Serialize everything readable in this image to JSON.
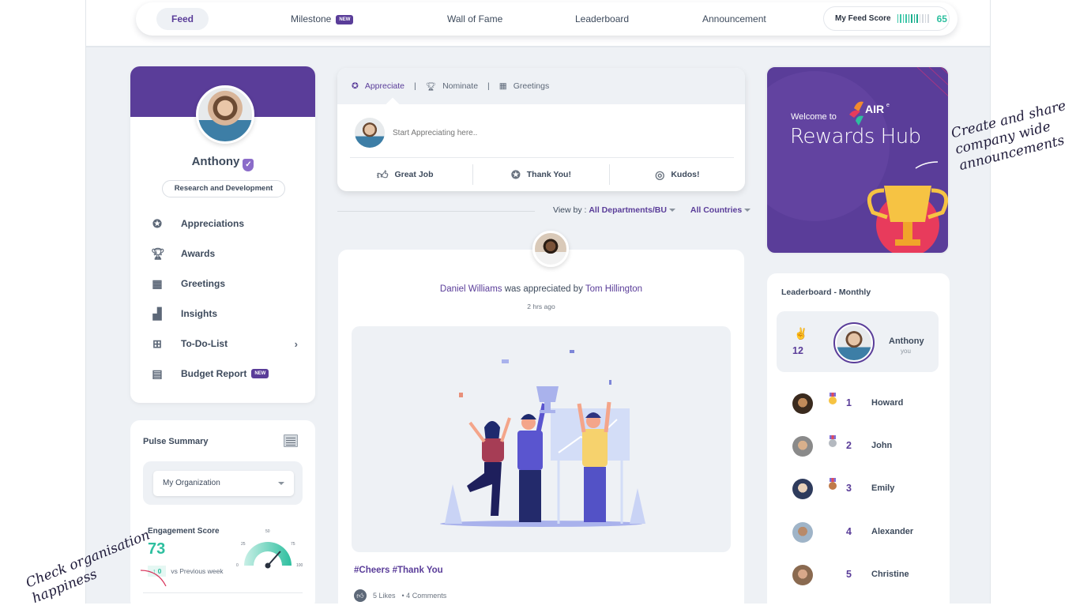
{
  "nav": {
    "tabs": [
      {
        "label": "Feed",
        "active": true
      },
      {
        "label": "Milestone",
        "badge": "NEW"
      },
      {
        "label": "Wall of Fame"
      },
      {
        "label": "Leaderboard"
      },
      {
        "label": "Announcement"
      }
    ],
    "feed_score": {
      "label": "My Feed Score",
      "value": "65",
      "segments_total": 12,
      "segments_filled": 8
    }
  },
  "profile": {
    "name": "Anthony",
    "verified_icon": "shield-check-icon",
    "department": "Research and Development",
    "menu": [
      {
        "label": "Appreciations",
        "icon": "ribbon-icon"
      },
      {
        "label": "Awards",
        "icon": "trophy-icon"
      },
      {
        "label": "Greetings",
        "icon": "gift-icon"
      },
      {
        "label": "Insights",
        "icon": "chart-icon"
      },
      {
        "label": "To-Do-List",
        "icon": "grid-icon",
        "has_submenu": true
      },
      {
        "label": "Budget Report",
        "icon": "clipboard-icon",
        "badge": "NEW"
      }
    ]
  },
  "pulse": {
    "title": "Pulse Summary",
    "org_select": "My Organization",
    "engagement_label": "Engagement Score",
    "engagement_value": "73",
    "delta": "0",
    "delta_label": "vs Previous week",
    "gauge": {
      "min": "0",
      "t25": "25",
      "t50": "50",
      "t75": "75",
      "max": "100",
      "value": 73
    }
  },
  "compose": {
    "tabs": [
      {
        "label": "Appreciate",
        "icon": "ribbon-icon",
        "active": true
      },
      {
        "label": "Nominate",
        "icon": "trophy-icon"
      },
      {
        "label": "Greetings",
        "icon": "gift-icon"
      }
    ],
    "placeholder": "Start Appreciating here..",
    "actions": [
      {
        "label": "Great Job",
        "icon": "thumbs-up-icon"
      },
      {
        "label": "Thank You!",
        "icon": "ribbon-icon"
      },
      {
        "label": "Kudos!",
        "icon": "badge-icon"
      }
    ]
  },
  "filters": {
    "label": "View by :",
    "department": "All Departments/BU",
    "country": "All Countries"
  },
  "post": {
    "recipient": "Daniel Williams",
    "verb": "was appreciated by",
    "sender": "Tom Hillington",
    "time": "2 hrs ago",
    "tags": "#Cheers #Thank You",
    "likes": "5 Likes",
    "comments": "• 4 Comments"
  },
  "rewards": {
    "welcome": "Welcome to",
    "brand": "AIR",
    "title": "Rewards Hub"
  },
  "leaderboard": {
    "title": "Leaderboard - Monthly",
    "me": {
      "count": "12",
      "name": "Anthony",
      "tag": "you"
    },
    "rows": [
      {
        "rank": "1",
        "name": "Howard",
        "medal": "gold"
      },
      {
        "rank": "2",
        "name": "John",
        "medal": "silver"
      },
      {
        "rank": "3",
        "name": "Emily",
        "medal": "bronze"
      },
      {
        "rank": "4",
        "name": "Alexander"
      },
      {
        "rank": "5",
        "name": "Christine"
      }
    ]
  },
  "annotations": {
    "right": "Create and share company wide announcements",
    "left": "Check organisation happiness"
  },
  "colors": {
    "brand": "#5a3d99",
    "accent": "#2ebf9f",
    "bg": "#eef1f5"
  }
}
